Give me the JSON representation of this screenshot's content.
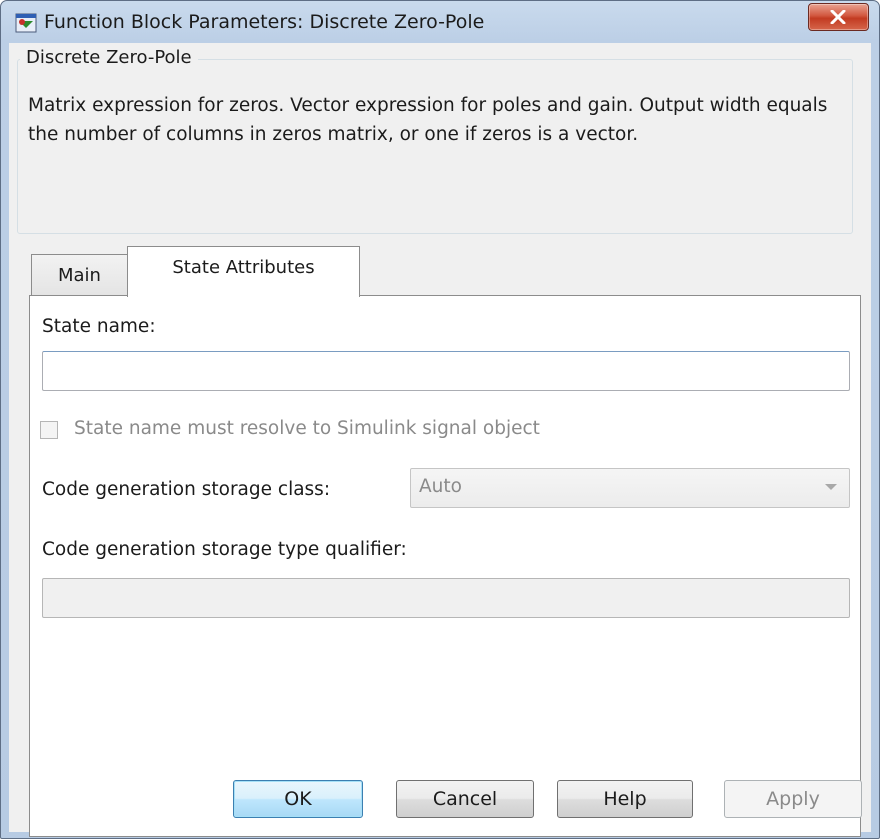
{
  "window": {
    "title": "Function Block Parameters: Discrete Zero-Pole"
  },
  "description": {
    "legend": "Discrete Zero-Pole",
    "text": "Matrix expression for zeros.  Vector expression for poles and gain. Output width equals the number of columns in zeros matrix, or one if zeros is a vector."
  },
  "tabs": [
    {
      "label": "Main",
      "selected": false
    },
    {
      "label": "State Attributes",
      "selected": true
    }
  ],
  "state_attributes": {
    "state_name_label": "State name:",
    "state_name_value": "",
    "resolve_checkbox_label": "State name must resolve to Simulink signal object",
    "resolve_checked": false,
    "storage_class_label": "Code generation storage class:",
    "storage_class_value": "Auto",
    "type_qualifier_label": "Code generation storage type qualifier:",
    "type_qualifier_value": ""
  },
  "buttons": {
    "ok": "OK",
    "cancel": "Cancel",
    "help": "Help",
    "apply": "Apply"
  },
  "colors": {
    "title_bar": "#bccfe6",
    "close_button": "#c23b22",
    "client_background": "#f0f0f0",
    "default_button": "#bee6fd",
    "disabled_text": "#8a8a8a"
  },
  "icons": {
    "app": "simulink-block-icon",
    "close": "close-x-icon",
    "combo": "chevron-down-icon"
  }
}
